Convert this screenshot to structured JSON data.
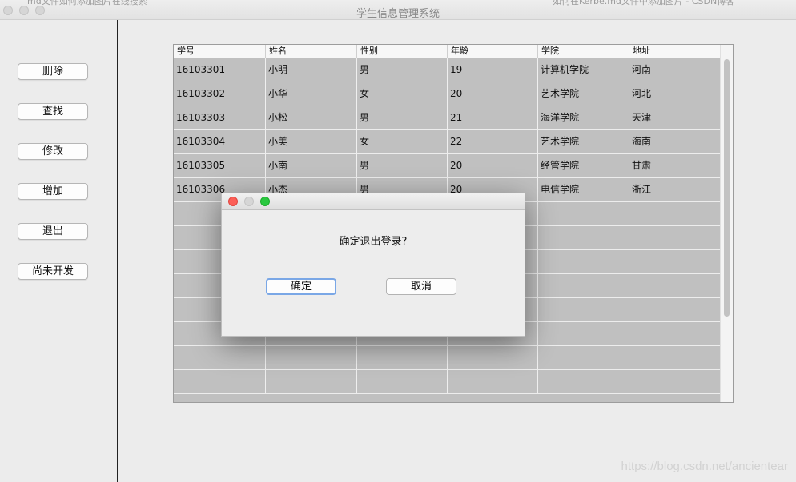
{
  "window": {
    "title": "学生信息管理系统",
    "top_left_cut": "md文件如何添加图片在线搜索",
    "top_right_cut": "如何在Kerbe.md文件中添加图片 - CSDN博客"
  },
  "sidebar": {
    "buttons": [
      {
        "label": "删除"
      },
      {
        "label": "查找"
      },
      {
        "label": "修改"
      },
      {
        "label": "增加"
      },
      {
        "label": "退出"
      },
      {
        "label": "尚未开发"
      }
    ]
  },
  "table": {
    "columns": [
      "学号",
      "姓名",
      "性别",
      "年龄",
      "学院",
      "地址"
    ],
    "rows": [
      [
        "16103301",
        "小明",
        "男",
        "19",
        "计算机学院",
        "河南"
      ],
      [
        "16103302",
        "小华",
        "女",
        "20",
        "艺术学院",
        "河北"
      ],
      [
        "16103303",
        "小松",
        "男",
        "21",
        "海洋学院",
        "天津"
      ],
      [
        "16103304",
        "小美",
        "女",
        "22",
        "艺术学院",
        "海南"
      ],
      [
        "16103305",
        "小南",
        "男",
        "20",
        "经管学院",
        "甘肃"
      ],
      [
        "16103306",
        "小杰",
        "男",
        "20",
        "电信学院",
        "浙江"
      ]
    ],
    "empty_rows": 8
  },
  "dialog": {
    "message": "确定退出登录?",
    "confirm_label": "确定",
    "cancel_label": "取消",
    "colors": {
      "close": "#fc5f57",
      "minimize": "#d6d6d6",
      "zoom": "#2ac840"
    }
  },
  "watermark": "https://blog.csdn.net/ancientear"
}
